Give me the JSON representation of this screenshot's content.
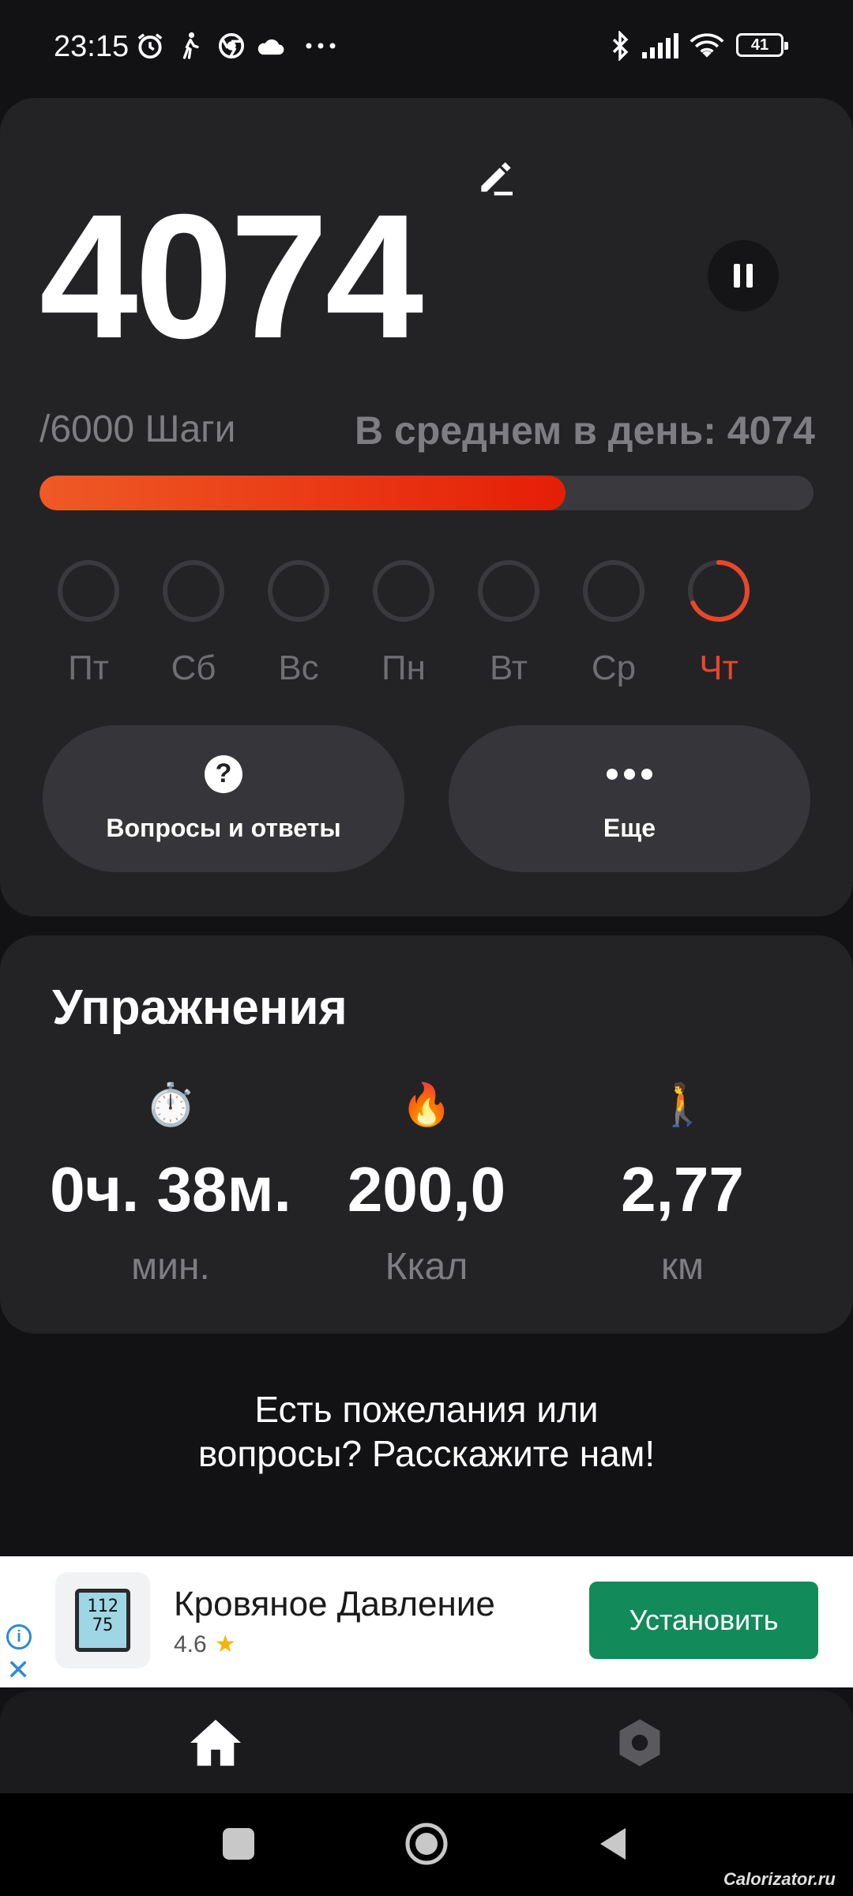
{
  "status_bar": {
    "time": "23:15",
    "left_icons": [
      "alarm-icon",
      "walking-icon",
      "chrome-icon",
      "cloud-icon",
      "more-dots-icon"
    ],
    "right_icons": [
      "bluetooth-icon",
      "signal-icon",
      "wifi-icon",
      "battery-icon"
    ],
    "battery_level": "41"
  },
  "steps": {
    "count": "4074",
    "goal_text": "/6000 Шаги",
    "average_text": "В среднем в день: 4074",
    "progress": 0.68,
    "accent_color": "#e8472a",
    "days": [
      {
        "label": "Пт",
        "progress": 0,
        "active": false
      },
      {
        "label": "Сб",
        "progress": 0,
        "active": false
      },
      {
        "label": "Вс",
        "progress": 0,
        "active": false
      },
      {
        "label": "Пн",
        "progress": 0,
        "active": false
      },
      {
        "label": "Вт",
        "progress": 0,
        "active": false
      },
      {
        "label": "Ср",
        "progress": 0,
        "active": false
      },
      {
        "label": "Чт",
        "progress": 0.68,
        "active": true
      }
    ],
    "faq_button": "Вопросы и ответы",
    "more_button": "Еще"
  },
  "exercises": {
    "title": "Упражнения",
    "stats": [
      {
        "icon": "stopwatch-icon",
        "emoji": "⏱️",
        "value": "0ч. 38м.",
        "unit": "мин."
      },
      {
        "icon": "fire-icon",
        "emoji": "🔥",
        "value": "200,0",
        "unit": "Ккал"
      },
      {
        "icon": "walking-person-icon",
        "emoji": "🚶",
        "value": "2,77",
        "unit": "км"
      }
    ]
  },
  "feedback": {
    "line1": "Есть пожелания или",
    "line2": "вопросы? Расскажите нам!"
  },
  "ad": {
    "app_name": "Кровяное Давление",
    "rating": "4.6",
    "install_label": "Установить",
    "icon_line1": "112",
    "icon_line2": "75"
  },
  "bottom_nav": {
    "items": [
      "home-icon",
      "settings-icon"
    ]
  },
  "watermark": "Calorizator.ru"
}
